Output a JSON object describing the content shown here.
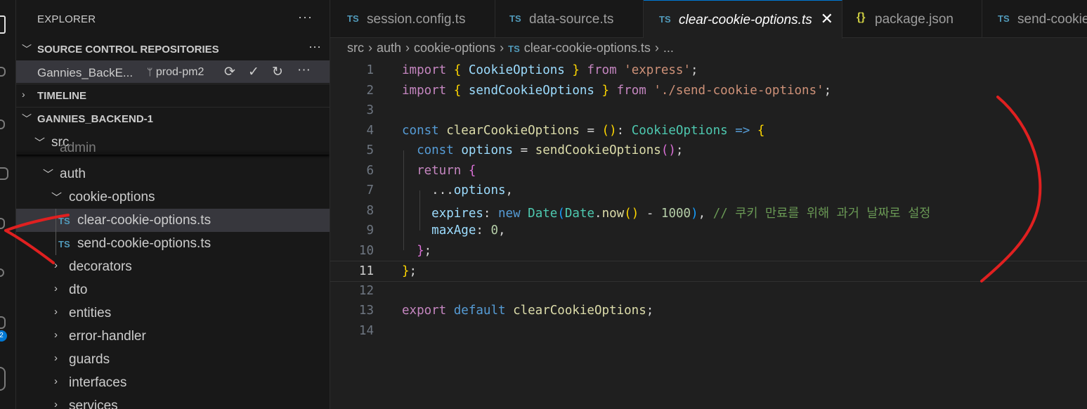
{
  "colors": {
    "accent": "#0078d4",
    "ts_icon": "#519aba",
    "json_icon": "#cbcb41",
    "annotation": "#e02020"
  },
  "activity_bar": {
    "badge_count": "2"
  },
  "sidebar": {
    "title": "EXPLORER",
    "more_icon": "more-icon",
    "sections": {
      "source_control": "SOURCE CONTROL REPOSITORIES",
      "timeline": "TIMELINE",
      "project": "GANNIES_BACKEND-1"
    },
    "repo": {
      "name": "Gannies_BackE...",
      "branch": "prod-pm2",
      "actions": [
        "sync-icon",
        "check-icon",
        "refresh-icon",
        "more-icon"
      ]
    },
    "tree": [
      {
        "label": "src",
        "expanded": true
      },
      {
        "label": "admin",
        "expanded": true
      },
      {
        "label": "auth",
        "expanded": true
      },
      {
        "label": "cookie-options",
        "expanded": true
      },
      {
        "label": "clear-cookie-options.ts",
        "badge": "TS",
        "selected": true
      },
      {
        "label": "send-cookie-options.ts",
        "badge": "TS"
      },
      {
        "label": "decorators",
        "expanded": false
      },
      {
        "label": "dto",
        "expanded": false
      },
      {
        "label": "entities",
        "expanded": false
      },
      {
        "label": "error-handler",
        "expanded": false
      },
      {
        "label": "guards",
        "expanded": false
      },
      {
        "label": "interfaces",
        "expanded": false
      },
      {
        "label": "services",
        "expanded": false
      }
    ]
  },
  "tabs": [
    {
      "label": "session.config.ts",
      "badge": "TS"
    },
    {
      "label": "data-source.ts",
      "badge": "TS"
    },
    {
      "label": "clear-cookie-options.ts",
      "badge": "TS",
      "active": true,
      "close": "✕"
    },
    {
      "label": "package.json",
      "badge": "{}"
    },
    {
      "label": "send-cookie",
      "badge": "TS"
    }
  ],
  "breadcrumb": {
    "parts": [
      "src",
      "auth",
      "cookie-options"
    ],
    "file": "clear-cookie-options.ts",
    "badge": "TS",
    "ellipsis": "..."
  },
  "editor": {
    "current_line": 11,
    "line_numbers": [
      "1",
      "2",
      "3",
      "4",
      "5",
      "6",
      "7",
      "8",
      "9",
      "10",
      "11",
      "12",
      "13",
      "14"
    ],
    "lines": [
      "import { CookieOptions } from 'express';",
      "import { sendCookieOptions } from './send-cookie-options';",
      "",
      "const clearCookieOptions = (): CookieOptions => {",
      "  const options = sendCookieOptions();",
      "  return {",
      "    ...options,",
      "    expires: new Date(Date.now() - 1000), // 쿠키 만료를 위해 과거 날짜로 설정",
      "    maxAge: 0,",
      "  };",
      "};",
      "",
      "export default clearCookieOptions;",
      ""
    ]
  }
}
